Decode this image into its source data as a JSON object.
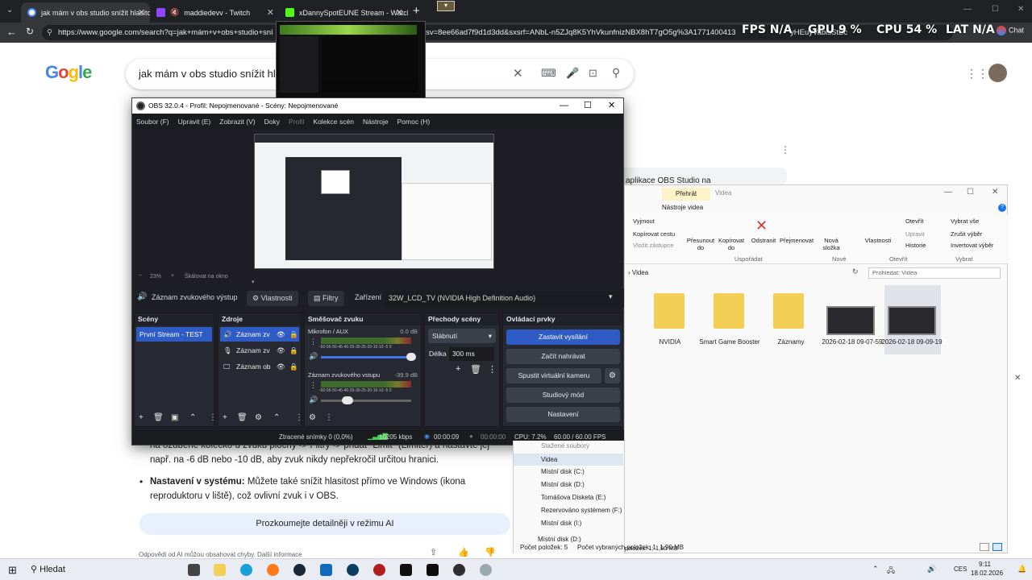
{
  "browser": {
    "tabs": [
      {
        "title": "jak mám v obs studio snížit hlasito",
        "active": true
      },
      {
        "title": "maddiedevv - Twitch",
        "active": false
      },
      {
        "title": "xDannySpotEUNE Stream - Watch",
        "active": false
      }
    ],
    "url": "https://www.google.com/search?q=jak+mám+v+obs+studio+sní",
    "url_tail": "zsca_esv=8ee66ad7f9d1d3dd&sxsrf=ANbL-n5ZJq8K5YhVkunfnizNBX8hT7gO5g%3A1771400413",
    "url_tail2": "yHEuyVabisStBc"
  },
  "overlay": {
    "fps_label": "FPS N/A",
    "gpu_label": "GPU",
    "gpu_value": "9 %",
    "cpu_label": "CPU",
    "cpu_value": "54 %",
    "lat_label": "LAT",
    "lat_value": "N/A",
    "chat_label": "Chat"
  },
  "google": {
    "logo": "Gogle",
    "query": "jak mám v obs studio snížit hlasi",
    "ai_heading": "aplikace OBS Studio na",
    "text_line1": "na ozubené kolečko u zvuku plochy -> Filtry -> přidat \"Limit\" (Limiter) a nastavte jej",
    "text_line2": "např. na -6 dB nebo -10 dB, aby zvuk nikdy nepřekročil určitou hranici.",
    "bullet_bold": "Nastavení v systému:",
    "bullet_text": " Můžete také snížit hlasitost přímo ve Windows (ikona",
    "bullet_text2": "reproduktoru v liště), což ovlivní zvuk i v OBS.",
    "ai_button": "Prozkoumejte detailněji v režimu AI",
    "disclaimer": "Odpovědi od AI můžou obsahovat chyby. Další informace"
  },
  "obs": {
    "title": "OBS 32.0.4 - Profil: Nepojmenované - Scény: Nepojmenované",
    "menu": [
      "Soubor (F)",
      "Upravit (E)",
      "Zobrazit (V)",
      "Doky",
      "Profil",
      "Kolekce scén",
      "Nástroje",
      "Pomoc (H)"
    ],
    "zoom": "23%",
    "scale": "Škálovat na okno",
    "source_name": "Záznam zvukového výstup",
    "properties": "Vlastnosti",
    "filters": "Filtry",
    "device_label": "Zařízení",
    "device_value": "32W_LCD_TV (NVIDIA High Definition Audio)",
    "docks": {
      "scenes": {
        "title": "Scény",
        "items": [
          "První Stream - TEST"
        ]
      },
      "sources": {
        "title": "Zdroje",
        "items": [
          "Záznam zv",
          "Záznam zv",
          "Záznam ob"
        ]
      },
      "mixer": {
        "title": "Směšovač zvuku",
        "channels": [
          {
            "name": "Mikrofon / AUX",
            "db": "0.0 dB"
          },
          {
            "name": "Záznam zvukového vstupu",
            "db": "-39.9 dB"
          }
        ],
        "scale": "-60-55-50-45-40-35-30-25-20-15-10 -5 0"
      },
      "transitions": {
        "title": "Přechody scény",
        "type": "Slábnutí",
        "duration_label": "Délka",
        "duration": "300 ms"
      },
      "controls": {
        "title": "Ovládací prvky",
        "buttons": [
          "Zastavit vysílání",
          "Začít nahrávat",
          "Spustit virtuální kameru",
          "Studiový mód",
          "Nastavení"
        ]
      }
    },
    "status": {
      "dropped": "Ztracené snímky 0 (0,0%)",
      "kbps": "10205 kbps",
      "live": "00:00:09",
      "rec": "00:00:00",
      "cpu": "CPU: 7.2%",
      "fps": "60.00 / 60.00 FPS"
    }
  },
  "explorer": {
    "tabs": [
      "Přehrát",
      "Videa"
    ],
    "ribbon_tab2": "Nástroje videa",
    "ribbon": [
      "Vyjmout",
      "Kopírovat cestu",
      "Vložit zástupce",
      "Přesunout do",
      "Kopírovat do",
      "Odstranit",
      "Přejmenovat",
      "Nová složka",
      "Vlastnosti",
      "Otevřít",
      "Upravit",
      "Historie",
      "Vybrat vše",
      "Zrušit výběr",
      "Invertovat výběr"
    ],
    "groups": [
      "Uspořádat",
      "Nové",
      "Otevřít",
      "Vybrat"
    ],
    "breadcrumb": "Videa",
    "search_placeholder": "Prohledat: Videa",
    "items": [
      {
        "name": "NVIDIA",
        "type": "folder"
      },
      {
        "name": "Smart Game Booster",
        "type": "folder"
      },
      {
        "name": "Záznamy",
        "type": "folder"
      },
      {
        "name": "2026-02-18 09-07-59",
        "type": "video"
      },
      {
        "name": "2026-02-18 09-09-19",
        "type": "video"
      }
    ],
    "nav_items": [
      "Stažené soubory",
      "Videa",
      "Místní disk (C:)",
      "Místní disk (D:)",
      "Tomášova Disketa (E:)",
      "Rezervováno systémem (F:)",
      "Místní disk (I:)",
      "Místní disk (D:)"
    ],
    "status_count": "Počet položek: 5",
    "status_selected": "Počet vybraných položek: 1; 1,90 MB"
  },
  "taskbar": {
    "search": "Hledat",
    "lang": "CES",
    "time": "9:11",
    "date": "18.02.2026"
  }
}
